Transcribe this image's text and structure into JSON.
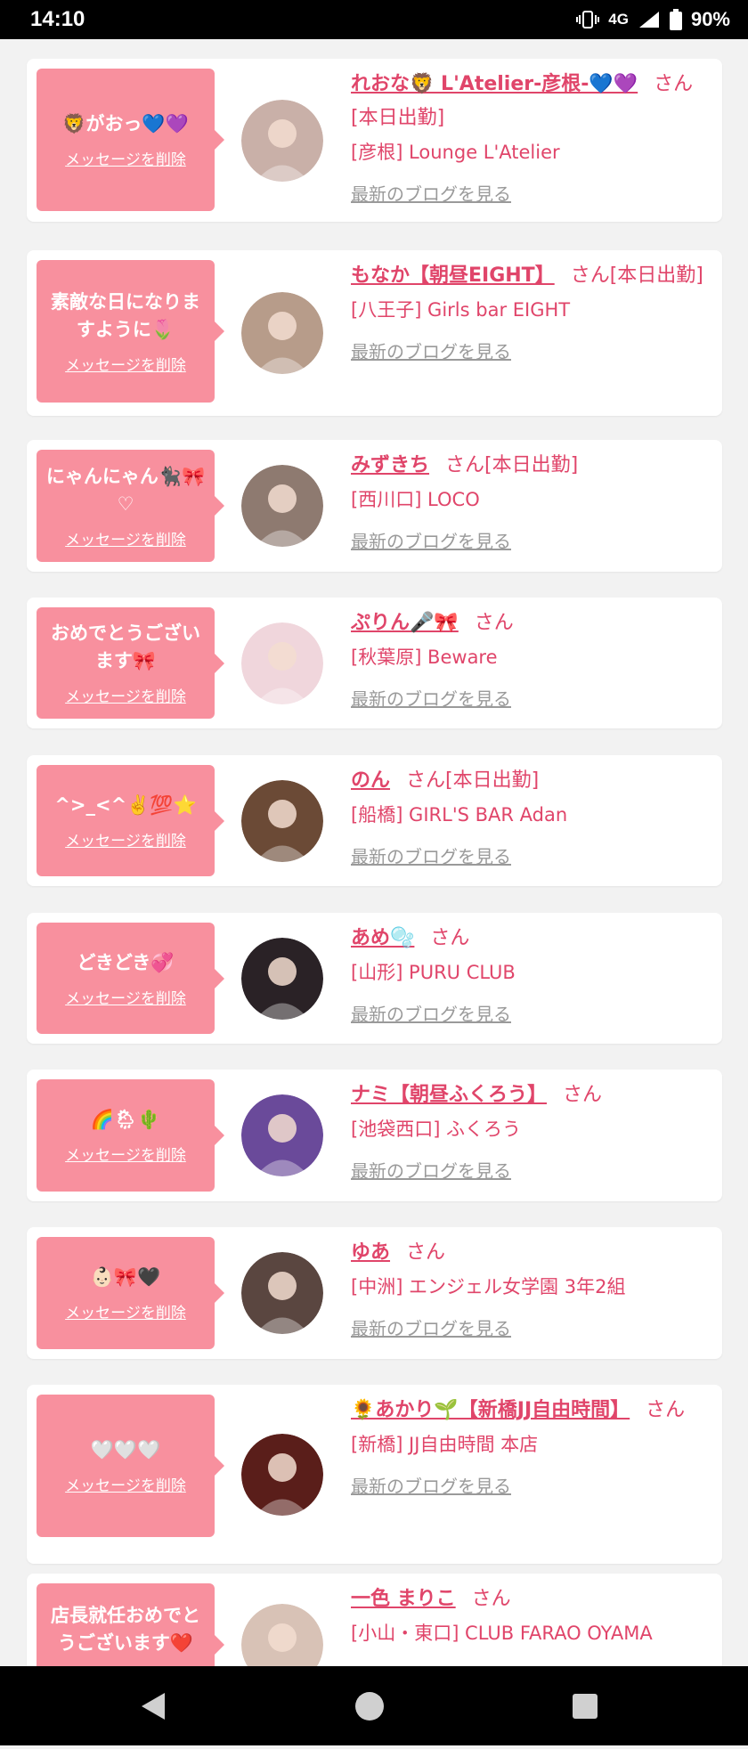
{
  "status": {
    "time": "14:10",
    "network": "4G",
    "battery": "90%"
  },
  "delete_label": "メッセージを削除",
  "blog_label": "最新のブログを見る",
  "san_label": "さん",
  "items": [
    {
      "message": "🦁がおっ💙💜",
      "name": "れおな🦁 L'Atelier-彦根-💙💜",
      "status": "[本日出勤]",
      "shop": "[彦根] Lounge L'Atelier",
      "avatar_color": "#c9b0a8"
    },
    {
      "message": "素敵な日になりますように🌷",
      "name": "もなか【朝昼EIGHT】",
      "status": "[本日出勤]",
      "shop": "[八王子] Girls bar EIGHT",
      "avatar_color": "#b79c8a"
    },
    {
      "message": "にゃんにゃん🐈‍⬛🎀♡",
      "name": "みずきち",
      "status": "[本日出勤]",
      "shop": "[西川口] LOCO",
      "avatar_color": "#8e7a70"
    },
    {
      "message": "おめでとうございます🎀",
      "name": "ぷりん🎤🎀",
      "status": "",
      "shop": "[秋葉原] Beware",
      "avatar_color": "#f0d6dc"
    },
    {
      "message": "^>_<^✌️💯⭐",
      "name": "のん",
      "status": "[本日出勤]",
      "shop": "[船橋] GIRL'S BAR Adan",
      "avatar_color": "#6b4a36"
    },
    {
      "message": "どきどき💞",
      "name": "あめ🫧",
      "status": "",
      "shop": "[山形] PURU CLUB",
      "avatar_color": "#2a2226"
    },
    {
      "message": "🌈🌦🌵",
      "name": "ナミ【朝昼ふくろう】",
      "status": "",
      "shop": "[池袋西口] ふくろう",
      "avatar_color": "#6a4a9a"
    },
    {
      "message": "👶🏻🎀🖤",
      "name": "ゆあ",
      "status": "",
      "shop": "[中洲] エンジェル女学園 3年2組",
      "avatar_color": "#5a4640"
    },
    {
      "message": "🤍🤍🤍",
      "name": "🌻あかり🌱【新橋JJ自由時間】",
      "status": "",
      "shop": "[新橋] JJ自由時間 本店",
      "avatar_color": "#5a1e1a"
    },
    {
      "message": "店長就任おめでとうございます❤️",
      "name": "一色 まりこ",
      "status": "",
      "shop": "[小山・東口] CLUB FARAO OYAMA",
      "avatar_color": "#d8c2b6"
    }
  ]
}
